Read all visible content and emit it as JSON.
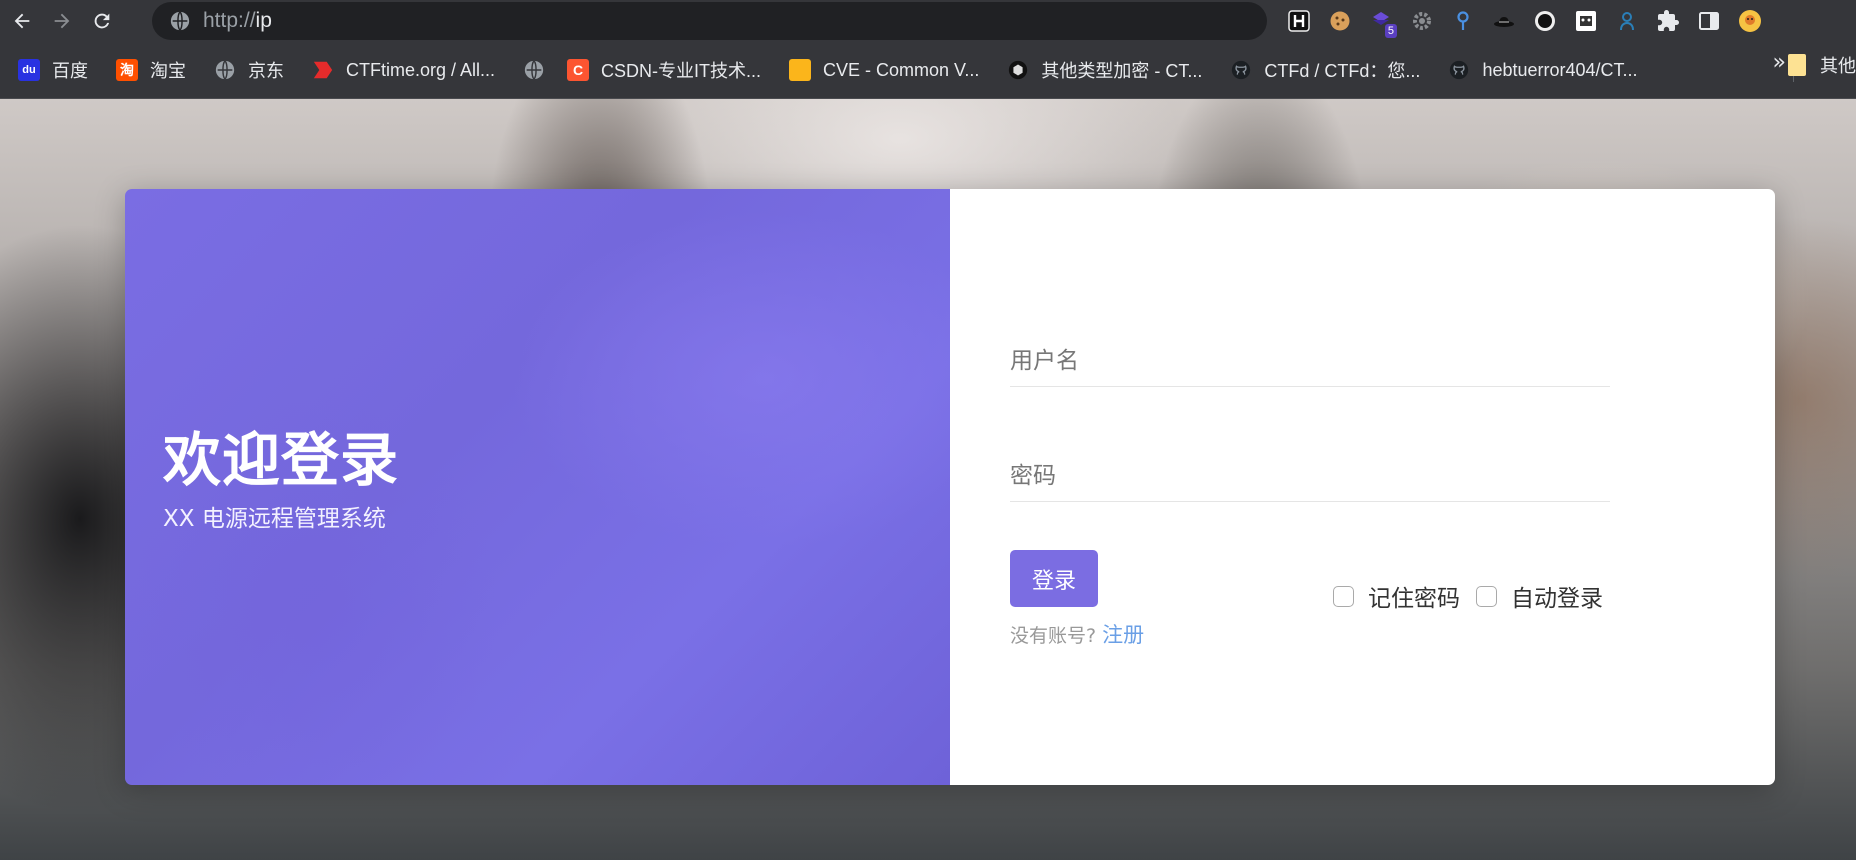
{
  "browser": {
    "url_scheme": "http://",
    "url_host": "ip",
    "extensions": [
      {
        "name": "h-extension-icon",
        "badge": ""
      },
      {
        "name": "cookie-icon",
        "badge": ""
      },
      {
        "name": "purple-extension-icon",
        "badge": "5"
      },
      {
        "name": "gear-icon",
        "badge": ""
      },
      {
        "name": "pin-icon",
        "badge": ""
      },
      {
        "name": "hat-icon",
        "badge": ""
      },
      {
        "name": "record-icon",
        "badge": ""
      },
      {
        "name": "cow-icon",
        "badge": ""
      },
      {
        "name": "person-icon",
        "badge": ""
      },
      {
        "name": "puzzle-icon",
        "badge": ""
      },
      {
        "name": "sidepanel-icon",
        "badge": ""
      },
      {
        "name": "profile-avatar-icon",
        "badge": ""
      }
    ]
  },
  "bookmarks": {
    "items": [
      {
        "label": "百度",
        "fav": "du",
        "color": "#2932e1"
      },
      {
        "label": "淘宝",
        "fav": "淘",
        "color": "#ff5000"
      },
      {
        "label": "京东",
        "fav": "",
        "color": "#9aa0a6"
      },
      {
        "label": "CTFtime.org / All...",
        "fav": "",
        "color": "#e52b2b"
      },
      {
        "label": "",
        "fav": "",
        "color": "#9aa0a6"
      },
      {
        "label": "CSDN-专业IT技术...",
        "fav": "C",
        "color": "#fc5531"
      },
      {
        "label": "CVE - Common V...",
        "fav": "",
        "color": "#fbb51b"
      },
      {
        "label": "其他类型加密 - CT...",
        "fav": "",
        "color": "#3c3c3c"
      },
      {
        "label": "CTFd / CTFd：您...",
        "fav": "",
        "color": "#24292e"
      },
      {
        "label": "hebtuerror404/CT...",
        "fav": "",
        "color": "#24292e"
      }
    ],
    "more": "»",
    "other": "其他"
  },
  "login": {
    "title": "欢迎登录",
    "subtitle": "XX 电源远程管理系统",
    "username_placeholder": "用户名",
    "password_placeholder": "密码",
    "login_button": "登录",
    "remember_label": "记住密码",
    "autologin_label": "自动登录",
    "no_account": "没有账号? ",
    "register_link": "注册"
  }
}
